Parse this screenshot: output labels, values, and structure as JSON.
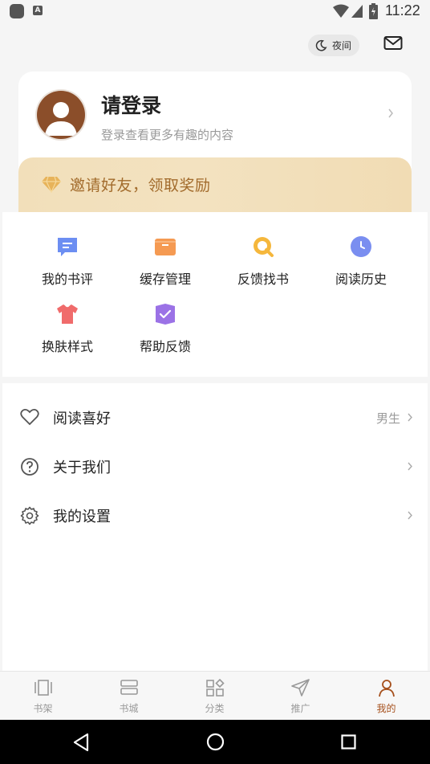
{
  "status_bar": {
    "time": "11:22"
  },
  "header": {
    "night_label": "夜间"
  },
  "profile": {
    "title": "请登录",
    "subtitle": "登录查看更多有趣的内容",
    "invite_label": "邀请好友，领取奖励"
  },
  "grid": [
    {
      "label": "我的书评",
      "icon": "review-icon",
      "color": "#6c8ef2"
    },
    {
      "label": "缓存管理",
      "icon": "folder-icon",
      "color": "#f59a52"
    },
    {
      "label": "反馈找书",
      "icon": "search-icon",
      "color": "#f5b73c"
    },
    {
      "label": "阅读历史",
      "icon": "clock-icon",
      "color": "#7a8ef0"
    },
    {
      "label": "换肤样式",
      "icon": "tshirt-icon",
      "color": "#f06b6b"
    },
    {
      "label": "帮助反馈",
      "icon": "help-feedback-icon",
      "color": "#9b72e6"
    }
  ],
  "list": [
    {
      "label": "阅读喜好",
      "value": "男生",
      "icon": "heart-icon"
    },
    {
      "label": "关于我们",
      "value": "",
      "icon": "question-icon"
    },
    {
      "label": "我的设置",
      "value": "",
      "icon": "gear-icon"
    }
  ],
  "tabs": [
    {
      "label": "书架",
      "icon": "bookshelf-icon"
    },
    {
      "label": "书城",
      "icon": "bookstore-icon"
    },
    {
      "label": "分类",
      "icon": "category-icon"
    },
    {
      "label": "推广",
      "icon": "send-icon"
    },
    {
      "label": "我的",
      "icon": "person-icon",
      "active": true
    }
  ],
  "colors": {
    "accent": "#a6501c",
    "invite_text": "#a26b2c",
    "avatar_bg": "#8b4e2a"
  }
}
